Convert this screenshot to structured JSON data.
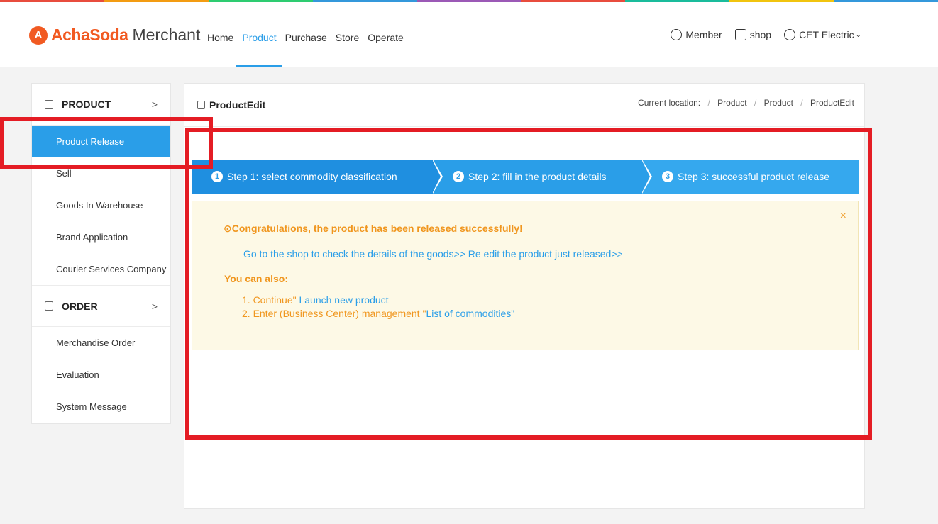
{
  "top_strip_colors": [
    "#e84c3d",
    "#f39c12",
    "#2ecc71",
    "#3498db",
    "#9b59b6",
    "#e84c3d",
    "#1abc9c",
    "#f1c40f",
    "#3498db"
  ],
  "header": {
    "logo_mark": "A",
    "logo_text": "AchaSoda",
    "logo_sub": "Merchant",
    "nav": [
      {
        "label": "Home"
      },
      {
        "label": "Product"
      },
      {
        "label": "Purchase"
      },
      {
        "label": "Store"
      },
      {
        "label": "Operate"
      }
    ],
    "active_nav": "Product",
    "user_nav": {
      "member": "Member",
      "shop": "shop",
      "account": "CET Electric",
      "account_chevron": "⌄"
    }
  },
  "sidebar": {
    "sections": [
      {
        "title": "PRODUCT",
        "arrow": ">",
        "items": [
          {
            "label": "Product Release"
          },
          {
            "label": "Sell"
          },
          {
            "label": "Goods In Warehouse"
          },
          {
            "label": "Brand Application"
          },
          {
            "label": "Courier Services Company"
          }
        ]
      },
      {
        "title": "ORDER",
        "arrow": ">",
        "items": [
          {
            "label": "Merchandise Order"
          },
          {
            "label": "Evaluation"
          },
          {
            "label": "System Message"
          }
        ]
      }
    ],
    "active_item": "Product Release"
  },
  "panel": {
    "title": "ProductEdit",
    "breadcrumb": {
      "prefix": "Current location:",
      "separator": "/",
      "items": [
        "Product",
        "Product",
        "ProductEdit"
      ]
    },
    "steps": [
      {
        "num": "1",
        "label": "Step 1: select commodity classification"
      },
      {
        "num": "2",
        "label": "Step 2: fill in the product details"
      },
      {
        "num": "3",
        "label": "Step 3: successful product release"
      }
    ],
    "success": {
      "close": "×",
      "title": "⊙Congratulations, the product has been released successfully!",
      "links": "Go to the shop to check the details of the goods>> Re edit the product just released>>",
      "also": "You can also:",
      "option1_prefix": "1. Continue\"",
      "option1_link": " Launch new product",
      "option2_prefix": "2. Enter (Business Center) management \"",
      "option2_link": "List of commodities\""
    }
  },
  "colors": {
    "accent": "#2a9ee8",
    "brand": "#f15a22",
    "warning": "#f0961e",
    "annotation": "#e41c24"
  }
}
